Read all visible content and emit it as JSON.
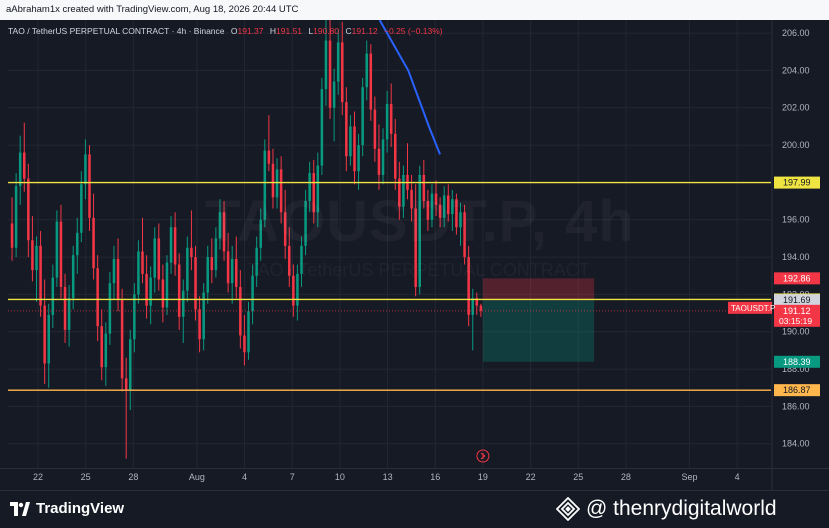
{
  "header": {
    "text": "aAbraham1x created with TradingView.com, Aug 18, 2026 20:44 UTC"
  },
  "legend": {
    "symbol": "TAO / TetherUS PERPETUAL CONTRACT · 4h · Binance",
    "o_label": "O",
    "o_value": "191.37",
    "h_label": "H",
    "h_value": "191.51",
    "l_label": "L",
    "l_value": "190.80",
    "c_label": "C",
    "c_value": "191.12",
    "change": "−0.25 (−0.13%)"
  },
  "watermark": {
    "symbol": "TAOUSDT.P, 4h",
    "description": "TAO / TetherUS PERPETUAL CONTRACT"
  },
  "footer": {
    "brand": "TradingView",
    "credit": "@ thenrydigitalworld"
  },
  "colors": {
    "background": "#161a25",
    "up": "#089981",
    "down": "#f23645",
    "yellow_line": "#f0e442",
    "orange_line": "#ffb74d",
    "trend": "#2962ff",
    "grid": "#232733"
  },
  "chart_data": {
    "type": "candlestick",
    "y_axis": {
      "min": 182.7,
      "max": 206.7,
      "ticks": [
        184,
        186,
        188,
        190,
        192,
        194,
        196,
        198,
        200,
        202,
        204,
        206
      ],
      "tick_labels": [
        "184.00",
        "186.00",
        "188.00",
        "190.00",
        "192.00",
        "194.00",
        "196.00",
        "198.00",
        "200.00",
        "202.00",
        "204.00",
        "206.00"
      ]
    },
    "x_axis": {
      "range_days": [
        0,
        45
      ],
      "ticks": [
        {
          "day": 0,
          "label": "22"
        },
        {
          "day": 3,
          "label": "25"
        },
        {
          "day": 6,
          "label": "28"
        },
        {
          "day": 10,
          "label": "Aug"
        },
        {
          "day": 13,
          "label": "4"
        },
        {
          "day": 16,
          "label": "7"
        },
        {
          "day": 19,
          "label": "10"
        },
        {
          "day": 22,
          "label": "13"
        },
        {
          "day": 25,
          "label": "16"
        },
        {
          "day": 28,
          "label": "19"
        },
        {
          "day": 31,
          "label": "22"
        },
        {
          "day": 34,
          "label": "25"
        },
        {
          "day": 37,
          "label": "28"
        },
        {
          "day": 41,
          "label": "Sep"
        },
        {
          "day": 44,
          "label": "4"
        }
      ]
    },
    "horizontal_lines": [
      {
        "price": 197.99,
        "label": "197.99",
        "color": "yellow"
      },
      {
        "price": 191.73,
        "label": "191.73",
        "color": "yellow"
      },
      {
        "price": 186.87,
        "label": "186.87",
        "color": "orange"
      }
    ],
    "price_labels": [
      {
        "price": 192.86,
        "label": "192.86",
        "kind": "stop"
      },
      {
        "price": 191.69,
        "label": "191.69",
        "kind": "entry"
      },
      {
        "price": 191.12,
        "label": "191.12",
        "kind": "last",
        "countdown": "03:15:19",
        "tag": "TAOUSDT.P"
      },
      {
        "price": 188.39,
        "label": "188.39",
        "kind": "target"
      }
    ],
    "position": {
      "entry": 191.69,
      "stop": 192.86,
      "target": 188.39,
      "start_day": 28.0,
      "end_day": 35.0
    },
    "trend_line": [
      {
        "day": 21.5,
        "price": 206.7
      },
      {
        "day": 23.3,
        "price": 204.0
      },
      {
        "day": 24.6,
        "price": 201.0
      },
      {
        "day": 25.3,
        "price": 199.5
      }
    ],
    "series": [
      [
        195.8,
        197.2,
        193.8,
        194.5
      ],
      [
        194.5,
        198.5,
        194.0,
        197.8
      ],
      [
        197.8,
        200.5,
        196.8,
        199.6
      ],
      [
        199.6,
        201.2,
        197.5,
        198.2
      ],
      [
        198.2,
        199.0,
        194.0,
        194.9
      ],
      [
        194.9,
        196.2,
        192.7,
        193.3
      ],
      [
        193.3,
        195.1,
        191.6,
        194.6
      ],
      [
        194.6,
        195.4,
        190.8,
        191.4
      ],
      [
        191.4,
        192.8,
        187.2,
        188.3
      ],
      [
        188.3,
        191.5,
        187.0,
        190.9
      ],
      [
        190.9,
        193.6,
        190.2,
        192.9
      ],
      [
        192.9,
        196.5,
        192.4,
        195.9
      ],
      [
        195.9,
        196.8,
        191.8,
        192.4
      ],
      [
        192.4,
        193.1,
        189.4,
        190.1
      ],
      [
        190.1,
        192.5,
        189.2,
        191.8
      ],
      [
        191.8,
        194.6,
        191.2,
        194.1
      ],
      [
        194.1,
        196.1,
        193.1,
        195.3
      ],
      [
        195.3,
        198.6,
        194.8,
        197.9
      ],
      [
        197.9,
        200.3,
        197.1,
        199.5
      ],
      [
        199.5,
        200.0,
        195.4,
        196.1
      ],
      [
        196.1,
        197.4,
        192.8,
        193.4
      ],
      [
        193.4,
        194.1,
        189.5,
        190.3
      ],
      [
        190.3,
        191.2,
        187.4,
        188.1
      ],
      [
        188.1,
        190.5,
        187.1,
        189.9
      ],
      [
        189.9,
        193.2,
        189.3,
        192.6
      ],
      [
        192.6,
        194.6,
        191.7,
        193.9
      ],
      [
        193.9,
        195.0,
        191.1,
        191.7
      ],
      [
        191.7,
        192.3,
        186.8,
        187.5
      ],
      [
        187.5,
        188.6,
        183.2,
        186.9
      ],
      [
        186.9,
        190.1,
        185.8,
        189.6
      ],
      [
        189.6,
        192.6,
        188.9,
        192.0
      ],
      [
        192.0,
        194.9,
        191.5,
        194.3
      ],
      [
        194.3,
        196.1,
        192.6,
        193.1
      ],
      [
        193.1,
        194.1,
        190.7,
        191.4
      ],
      [
        191.4,
        193.5,
        190.4,
        192.9
      ],
      [
        192.9,
        195.6,
        192.1,
        195.0
      ],
      [
        195.0,
        195.8,
        192.2,
        192.8
      ],
      [
        192.8,
        193.6,
        190.5,
        191.3
      ],
      [
        191.3,
        194.1,
        190.9,
        193.7
      ],
      [
        193.7,
        196.2,
        193.1,
        195.6
      ],
      [
        195.6,
        196.4,
        193.0,
        193.6
      ],
      [
        193.6,
        194.2,
        190.1,
        190.8
      ],
      [
        190.8,
        192.8,
        189.4,
        192.2
      ],
      [
        192.2,
        195.1,
        191.6,
        194.5
      ],
      [
        194.5,
        196.5,
        193.3,
        194.0
      ],
      [
        194.0,
        194.6,
        190.6,
        191.2
      ],
      [
        191.2,
        191.9,
        188.9,
        189.6
      ],
      [
        189.6,
        192.6,
        189.0,
        192.1
      ],
      [
        192.1,
        194.6,
        191.5,
        194.0
      ],
      [
        194.0,
        195.0,
        192.6,
        193.3
      ],
      [
        193.3,
        195.6,
        192.9,
        195.0
      ],
      [
        195.0,
        197.1,
        194.4,
        196.4
      ],
      [
        196.4,
        197.0,
        193.8,
        194.3
      ],
      [
        194.3,
        195.3,
        192.1,
        192.6
      ],
      [
        192.6,
        194.6,
        191.5,
        193.9
      ],
      [
        193.9,
        195.1,
        191.8,
        192.4
      ],
      [
        192.4,
        193.3,
        189.1,
        189.8
      ],
      [
        189.8,
        190.9,
        188.2,
        188.9
      ],
      [
        188.9,
        191.6,
        188.5,
        191.1
      ],
      [
        191.1,
        193.6,
        190.4,
        193.0
      ],
      [
        193.0,
        195.1,
        192.4,
        194.5
      ],
      [
        194.5,
        196.6,
        193.8,
        196.0
      ],
      [
        196.0,
        200.3,
        195.6,
        199.7
      ],
      [
        199.7,
        201.6,
        198.6,
        199.0
      ],
      [
        199.0,
        199.8,
        196.6,
        197.2
      ],
      [
        197.2,
        199.3,
        196.6,
        198.7
      ],
      [
        198.7,
        199.4,
        195.8,
        196.4
      ],
      [
        196.4,
        197.6,
        193.9,
        194.6
      ],
      [
        194.6,
        195.6,
        192.4,
        193.0
      ],
      [
        193.0,
        193.6,
        190.8,
        191.4
      ],
      [
        191.4,
        193.6,
        190.6,
        193.1
      ],
      [
        193.1,
        195.1,
        192.4,
        194.6
      ],
      [
        194.6,
        197.6,
        194.1,
        197.0
      ],
      [
        197.0,
        199.1,
        196.4,
        198.5
      ],
      [
        198.5,
        199.2,
        195.8,
        196.4
      ],
      [
        196.4,
        199.6,
        195.6,
        198.9
      ],
      [
        198.9,
        203.6,
        198.4,
        203.0
      ],
      [
        203.0,
        206.7,
        202.1,
        205.6
      ],
      [
        205.6,
        206.7,
        201.4,
        202.0
      ],
      [
        202.0,
        204.1,
        200.2,
        203.4
      ],
      [
        203.4,
        206.2,
        202.7,
        205.5
      ],
      [
        205.5,
        206.6,
        201.6,
        202.3
      ],
      [
        202.3,
        203.1,
        198.6,
        199.4
      ],
      [
        199.4,
        201.6,
        198.9,
        201.0
      ],
      [
        201.0,
        201.8,
        197.9,
        198.6
      ],
      [
        198.6,
        200.6,
        197.6,
        200.0
      ],
      [
        200.0,
        203.6,
        199.4,
        203.1
      ],
      [
        203.1,
        205.6,
        202.4,
        204.9
      ],
      [
        204.9,
        205.4,
        201.3,
        201.9
      ],
      [
        201.9,
        202.6,
        199.1,
        199.8
      ],
      [
        199.8,
        201.1,
        197.6,
        198.4
      ],
      [
        198.4,
        200.9,
        197.9,
        200.3
      ],
      [
        200.3,
        202.9,
        199.6,
        202.2
      ],
      [
        202.2,
        203.3,
        199.9,
        200.6
      ],
      [
        200.6,
        201.4,
        197.6,
        198.2
      ],
      [
        198.2,
        199.1,
        196.0,
        196.7
      ],
      [
        196.7,
        198.9,
        196.1,
        198.4
      ],
      [
        198.4,
        200.1,
        197.1,
        197.6
      ],
      [
        197.6,
        198.4,
        195.9,
        196.6
      ],
      [
        196.6,
        197.9,
        191.9,
        192.4
      ],
      [
        192.4,
        198.9,
        192.0,
        198.4
      ],
      [
        198.4,
        199.2,
        196.6,
        197.0
      ],
      [
        197.0,
        197.6,
        195.4,
        196.0
      ],
      [
        196.0,
        197.9,
        195.6,
        197.4
      ],
      [
        197.4,
        198.1,
        196.2,
        196.8
      ],
      [
        196.8,
        197.2,
        195.6,
        196.1
      ],
      [
        196.1,
        197.8,
        195.6,
        197.3
      ],
      [
        197.3,
        197.9,
        195.9,
        196.3
      ],
      [
        196.3,
        197.6,
        195.4,
        197.1
      ],
      [
        197.1,
        197.4,
        195.2,
        195.6
      ],
      [
        195.6,
        196.9,
        194.6,
        196.4
      ],
      [
        196.4,
        196.8,
        193.6,
        194.0
      ],
      [
        194.0,
        194.6,
        190.3,
        190.9
      ],
      [
        190.9,
        192.3,
        189.0,
        191.8
      ],
      [
        191.8,
        192.1,
        190.9,
        191.4
      ],
      [
        191.4,
        191.5,
        190.8,
        191.12
      ]
    ]
  }
}
